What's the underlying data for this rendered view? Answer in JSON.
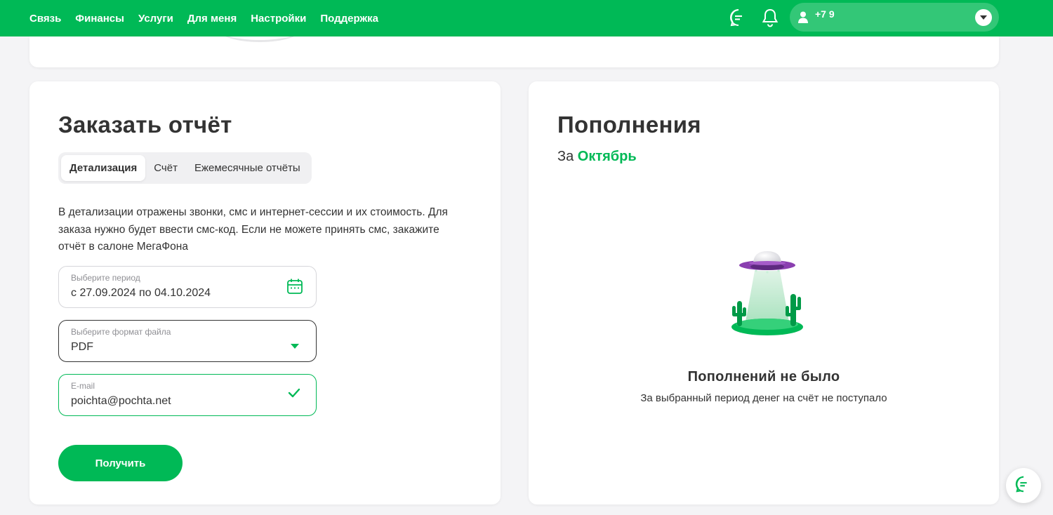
{
  "nav": {
    "items": [
      {
        "label": "Связь"
      },
      {
        "label": "Финансы"
      },
      {
        "label": "Услуги"
      },
      {
        "label": "Для меня"
      },
      {
        "label": "Настройки"
      },
      {
        "label": "Поддержка"
      }
    ]
  },
  "header": {
    "phone": "+7 9",
    "icons": [
      "chat-icon",
      "bell-icon",
      "user-icon",
      "chevron-down-icon"
    ]
  },
  "report": {
    "title": "Заказать отчёт",
    "tabs": [
      {
        "label": "Детализация",
        "active": true
      },
      {
        "label": "Счёт",
        "active": false
      },
      {
        "label": "Ежемесячные отчёты",
        "active": false
      }
    ],
    "description": "В детализации отражены звонки, смс и интернет-сессии и их стоимость. Для заказа нужно будет ввести смс-код. Если не можете принять смс, закажите отчёт в салоне МегаФона",
    "period": {
      "label": "Выберите период",
      "value": "с 27.09.2024 по 04.10.2024"
    },
    "format": {
      "label": "Выберите формат файла",
      "value": "PDF"
    },
    "email": {
      "label": "E-mail",
      "value": "poichta@pochta.net"
    },
    "submit_label": "Получить"
  },
  "topups": {
    "title": "Пополнения",
    "period_prefix": "За",
    "period_month": "Октябрь",
    "empty_title": "Пополнений не было",
    "empty_subtitle": "За выбранный период денег на счёт не поступало"
  },
  "colors": {
    "brand": "#00b956",
    "ufo": "#8a3fb0"
  }
}
